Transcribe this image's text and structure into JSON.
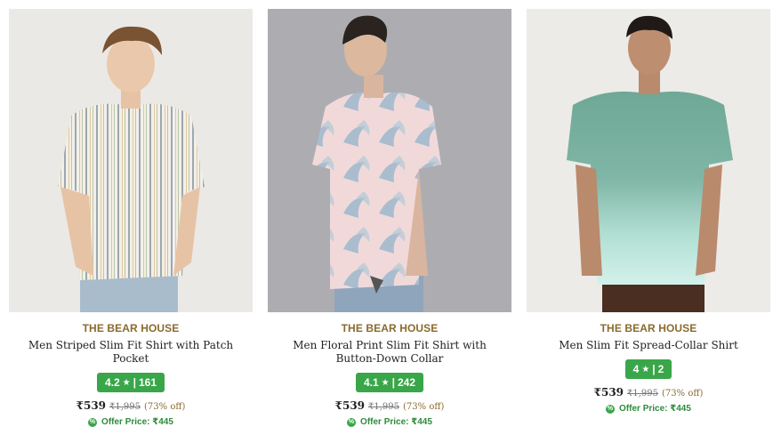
{
  "products": [
    {
      "brand": "THE BEAR HOUSE",
      "title": "Men Striped Slim Fit Shirt with Patch Pocket",
      "rating": "4.2",
      "reviews": "161",
      "price": "₹539",
      "mrp": "₹1,995",
      "discount": "(73% off)",
      "offer": "Offer Price: ₹445",
      "image_icon": "striped-shirt-model",
      "bg": "#ebe9e6",
      "shirt": "#f3efe8",
      "stripe": "#9aa9b2",
      "pants": "#a9bccb"
    },
    {
      "brand": "THE BEAR HOUSE",
      "title": "Men Floral Print Slim Fit Shirt with Button-Down Collar",
      "rating": "4.1",
      "reviews": "242",
      "price": "₹539",
      "mrp": "₹1,995",
      "discount": "(73% off)",
      "offer": "Offer Price: ₹445",
      "image_icon": "floral-shirt-model",
      "bg": "#a9a9ad",
      "shirt": "#f1d9da",
      "stripe": "#97b7cc",
      "pants": "#8fa5bb"
    },
    {
      "brand": "THE BEAR HOUSE",
      "title": "Men Slim Fit Spread-Collar Shirt",
      "rating": "4",
      "reviews": "2",
      "price": "₹539",
      "mrp": "₹1,995",
      "discount": "(73% off)",
      "offer": "Offer Price: ₹445",
      "image_icon": "ombre-shirt-model",
      "bg": "#ecebe8",
      "shirt": "#7fb6a6",
      "stripe": "#c5ece3",
      "pants": "#4a2e22"
    }
  ],
  "colors": {
    "brand_text": "#8a6a2e",
    "rating_badge": "#3aa64a",
    "offer_text": "#2e8b3a"
  }
}
